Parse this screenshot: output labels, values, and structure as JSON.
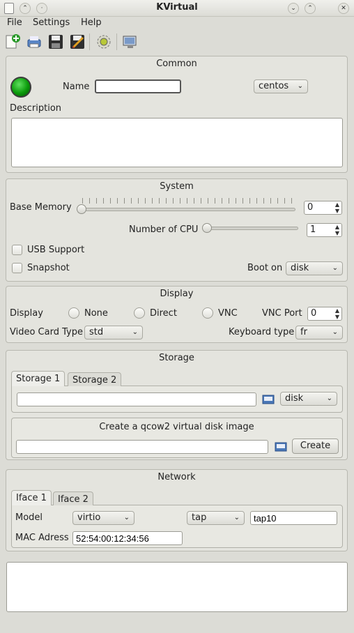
{
  "window": {
    "title": "KVirtual"
  },
  "menu": {
    "file": "File",
    "settings": "Settings",
    "help": "Help"
  },
  "toolbar": [
    "new-vm-icon",
    "print-icon",
    "save-icon",
    "save-as-icon",
    "settings-icon",
    "display-icon"
  ],
  "common": {
    "title": "Common",
    "name_label": "Name",
    "name_value": "",
    "os_value": "centos",
    "description_label": "Description",
    "description_value": "",
    "status_color": "#0a9a0a"
  },
  "system": {
    "title": "System",
    "base_memory_label": "Base Memory",
    "base_memory_value": "0",
    "cpu_label": "Number of CPU",
    "cpu_value": "1",
    "usb_label": "USB Support",
    "snapshot_label": "Snapshot",
    "boot_label": "Boot on",
    "boot_value": "disk"
  },
  "display": {
    "title": "Display",
    "display_label": "Display",
    "opt_none": "None",
    "opt_direct": "Direct",
    "opt_vnc": "VNC",
    "vnc_port_label": "VNC Port",
    "vnc_port_value": "0",
    "video_label": "Video Card Type",
    "video_value": "std",
    "keyboard_label": "Keyboard type",
    "keyboard_value": "fr"
  },
  "storage": {
    "title": "Storage",
    "tab1": "Storage 1",
    "tab2": "Storage 2",
    "path_value": "",
    "type_value": "disk",
    "qcow_title": "Create a qcow2 virtual disk image",
    "qcow_path": "",
    "create_label": "Create"
  },
  "network": {
    "title": "Network",
    "tab1": "Iface 1",
    "tab2": "Iface 2",
    "model_label": "Model",
    "model_value": "virtio",
    "mode_value": "tap",
    "iface_value": "tap10",
    "mac_label": "MAC Adress",
    "mac_value": "52:54:00:12:34:56"
  },
  "log": {
    "text": ""
  }
}
